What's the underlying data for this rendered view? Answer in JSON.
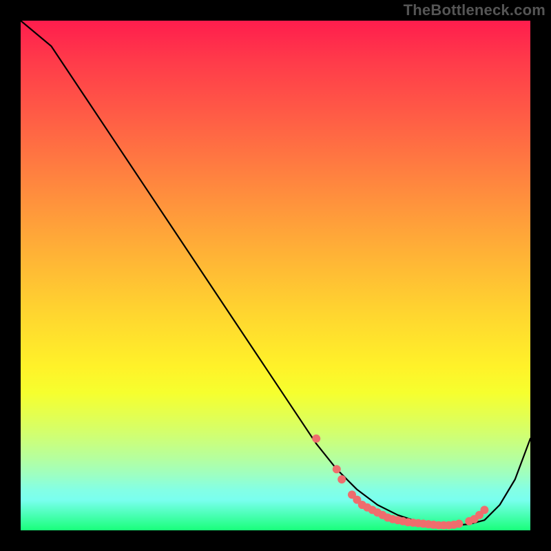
{
  "watermark": "TheBottleneck.com",
  "colors": {
    "frame_bg": "#000000",
    "line": "#000000",
    "marker": "#ef6d6d",
    "gradient_top": "#ff1d4d",
    "gradient_bottom": "#19ff7a"
  },
  "chart_data": {
    "type": "line",
    "title": "",
    "xlabel": "",
    "ylabel": "",
    "xlim": [
      0,
      100
    ],
    "ylim": [
      0,
      100
    ],
    "grid": false,
    "x": [
      0,
      6,
      12,
      18,
      24,
      30,
      36,
      42,
      48,
      54,
      58,
      62,
      66,
      70,
      74,
      77,
      79,
      81,
      83,
      85,
      88,
      91,
      94,
      97,
      100
    ],
    "values": [
      100,
      95,
      86,
      77,
      68,
      59,
      50,
      41,
      32,
      23,
      17,
      12,
      8,
      5,
      3,
      2,
      1.5,
      1.2,
      1,
      1,
      1.2,
      2,
      5,
      10,
      18
    ],
    "markers_x": [
      58,
      62,
      63,
      65,
      66,
      67,
      68,
      69,
      70,
      71,
      72,
      73,
      74,
      75,
      76,
      77,
      78,
      79,
      80,
      81,
      82,
      83,
      84,
      85,
      86,
      88,
      89,
      90,
      91
    ],
    "markers_y": [
      18,
      12,
      10,
      7,
      6,
      5,
      4.5,
      4,
      3.5,
      3,
      2.5,
      2.2,
      2,
      1.8,
      1.6,
      1.5,
      1.4,
      1.3,
      1.2,
      1.1,
      1,
      1,
      1,
      1.1,
      1.3,
      1.8,
      2.2,
      3,
      4
    ]
  }
}
